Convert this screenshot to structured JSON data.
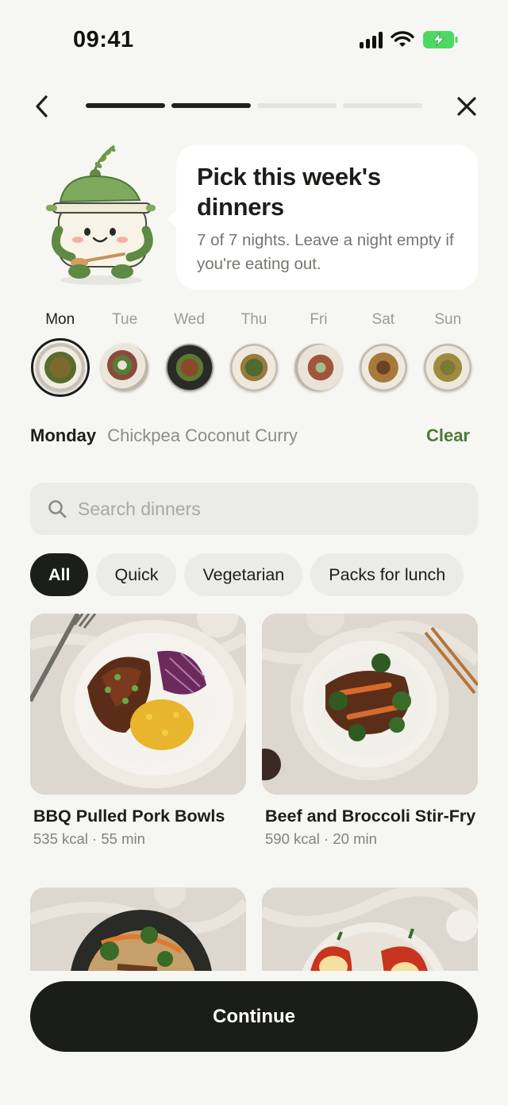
{
  "status_bar": {
    "time": "09:41"
  },
  "nav": {
    "progress_total": 4,
    "progress_completed": 2
  },
  "hero": {
    "title": "Pick this week's dinners",
    "subtitle": "7 of 7 nights. Leave a night empty if you're eating out."
  },
  "week": {
    "days": [
      {
        "label": "Mon",
        "active": true
      },
      {
        "label": "Tue",
        "active": false
      },
      {
        "label": "Wed",
        "active": false
      },
      {
        "label": "Thu",
        "active": false
      },
      {
        "label": "Fri",
        "active": false
      },
      {
        "label": "Sat",
        "active": false
      },
      {
        "label": "Sun",
        "active": false
      }
    ]
  },
  "selection": {
    "day": "Monday",
    "meal": "Chickpea Coconut Curry",
    "clear_label": "Clear"
  },
  "search": {
    "placeholder": "Search dinners",
    "value": ""
  },
  "filters": [
    "All",
    "Quick",
    "Vegetarian",
    "Packs for lunch"
  ],
  "filters_selected": "All",
  "dinners": [
    {
      "name": "BBQ Pulled Pork Bowls",
      "meta": "535 kcal · 55 min"
    },
    {
      "name": "Beef and Broccoli Stir-Fry",
      "meta": "590 kcal · 20 min"
    },
    {
      "name": "",
      "meta": ""
    },
    {
      "name": "",
      "meta": ""
    }
  ],
  "cta": {
    "label": "Continue"
  },
  "colors": {
    "accent_green": "#4f7a35",
    "dark": "#1b1d1a",
    "background": "#f6f6f3"
  }
}
